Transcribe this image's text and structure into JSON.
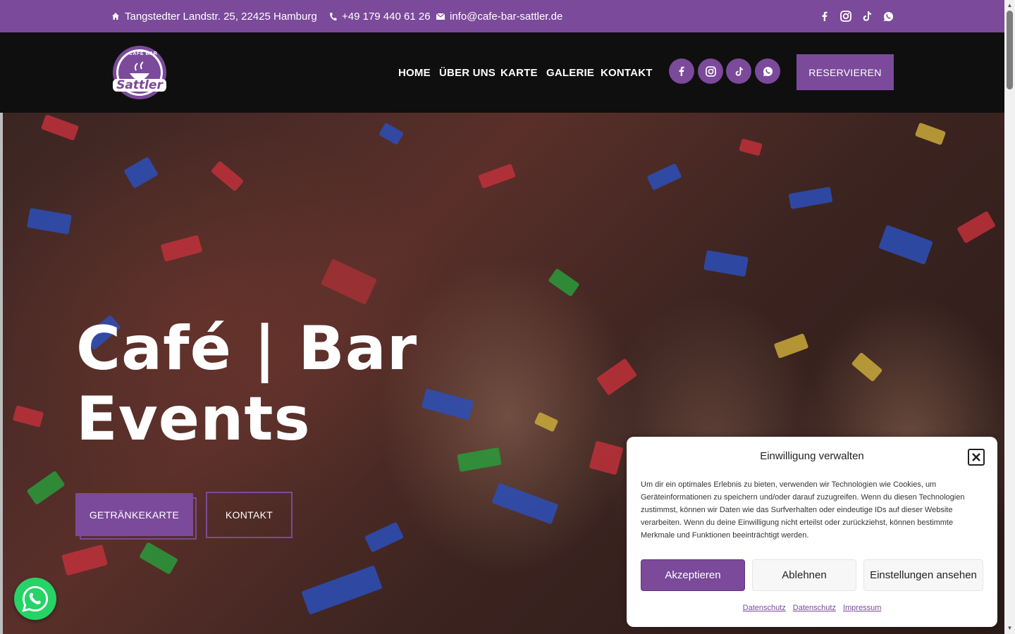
{
  "topbar": {
    "address": "Tangstedter Landstr. 25, 22425 Hamburg",
    "phone": "+49 179 440 61 26",
    "email": "info@cafe-bar-sattler.de",
    "social_icons": [
      "facebook-icon",
      "instagram-icon",
      "tiktok-icon",
      "whatsapp-icon"
    ]
  },
  "header": {
    "logo_top": "CAFÉ BAR",
    "logo_name": "Sattler",
    "nav": [
      "HOME",
      "ÜBER UNS",
      "KARTE",
      "GALERIE",
      "KONTAKT"
    ],
    "reserve_label": "RESERVIEREN"
  },
  "hero": {
    "title_line1": "Café | Bar",
    "title_line2": "Events",
    "btn_drinks": "GETRÄNKEKARTE",
    "btn_contact": "KONTAKT"
  },
  "consent": {
    "title": "Einwilligung verwalten",
    "text": "Um dir ein optimales Erlebnis zu bieten, verwenden wir Technologien wie Cookies, um Geräteinformationen zu speichern und/oder darauf zuzugreifen. Wenn du diesen Technologien zustimmst, können wir Daten wie das Surfverhalten oder eindeutige IDs auf dieser Website verarbeiten. Wenn du deine Einwilligung nicht erteilst oder zurückziehst, können bestimmte Merkmale und Funktionen beeinträchtigt werden.",
    "accept": "Akzeptieren",
    "deny": "Ablehnen",
    "preferences": "Einstellungen ansehen",
    "links": [
      "Datenschutz",
      "Datenschutz",
      "Impressum"
    ]
  },
  "colors": {
    "brand": "#7b4a9a",
    "header_bg": "#0f0f0f",
    "whatsapp": "#25d366"
  }
}
